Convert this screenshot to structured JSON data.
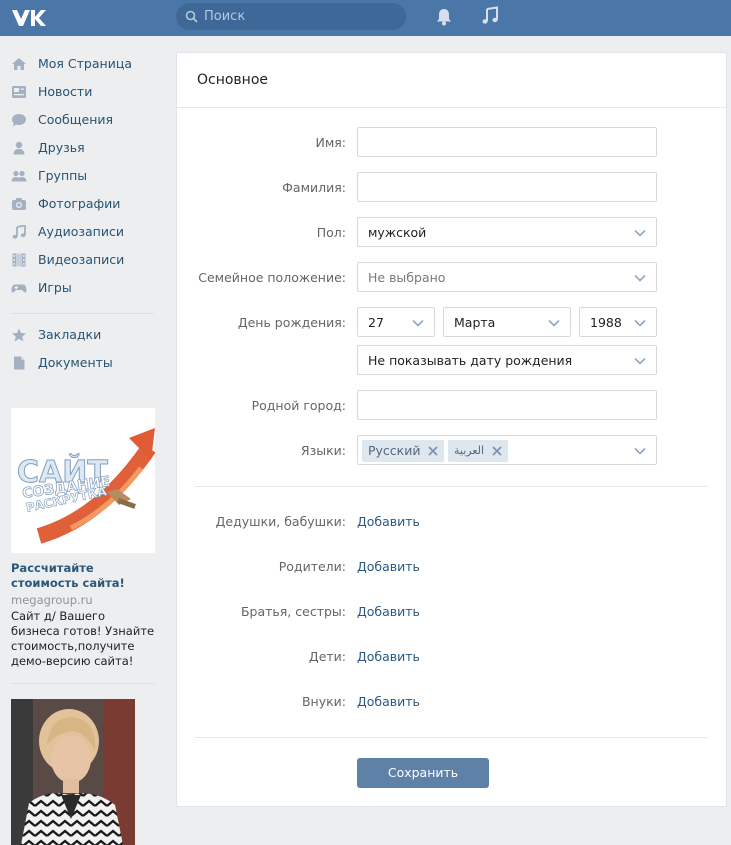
{
  "header": {
    "search_placeholder": "Поиск",
    "icons": [
      "vk-logo-icon",
      "search-icon",
      "bell-icon",
      "music-icon"
    ]
  },
  "nav": {
    "items": [
      {
        "label": "Моя Страница",
        "icon": "home-icon"
      },
      {
        "label": "Новости",
        "icon": "news-icon"
      },
      {
        "label": "Сообщения",
        "icon": "messages-icon"
      },
      {
        "label": "Друзья",
        "icon": "friend-icon"
      },
      {
        "label": "Группы",
        "icon": "groups-icon"
      },
      {
        "label": "Фотографии",
        "icon": "camera-icon"
      },
      {
        "label": "Аудиозаписи",
        "icon": "music-icon"
      },
      {
        "label": "Видеозаписи",
        "icon": "film-icon"
      },
      {
        "label": "Игры",
        "icon": "gamepad-icon"
      }
    ],
    "items2": [
      {
        "label": "Закладки",
        "icon": "star-icon"
      },
      {
        "label": "Документы",
        "icon": "document-icon"
      }
    ]
  },
  "ad": {
    "image_text_1": "САЙТ",
    "image_text_2": "СОЗДАНИЕ",
    "image_text_3": "РАСКРУТКА",
    "title": "Рассчитайте стоимость сайта!",
    "domain": "megagroup.ru",
    "text": "Сайт д/ Вашего бизнеса готов! Узнайте стоимость,получите демо-версию сайта!"
  },
  "form": {
    "title": "Основное",
    "first_name_label": "Имя:",
    "first_name_value": "",
    "last_name_label": "Фамилия:",
    "last_name_value": "",
    "gender_label": "Пол:",
    "gender_value": "мужской",
    "relationship_label": "Семейное положение:",
    "relationship_value": "Не выбрано",
    "birthday_label": "День рождения:",
    "birth_day": "27",
    "birth_month": "Марта",
    "birth_year": "1988",
    "birthday_visibility": "Не показывать дату рождения",
    "hometown_label": "Родной город:",
    "hometown_value": "",
    "languages_label": "Языки:",
    "languages": [
      "Русский",
      "العربية"
    ]
  },
  "relatives": {
    "grandparents_label": "Дедушки, бабушки:",
    "parents_label": "Родители:",
    "siblings_label": "Братья, сестры:",
    "children_label": "Дети:",
    "grandchildren_label": "Внуки:",
    "add_label": "Добавить"
  },
  "save_label": "Сохранить",
  "colors": {
    "header": "#4a76a8",
    "link": "#2a5885",
    "button": "#5e81a8",
    "background": "#edeef0"
  }
}
